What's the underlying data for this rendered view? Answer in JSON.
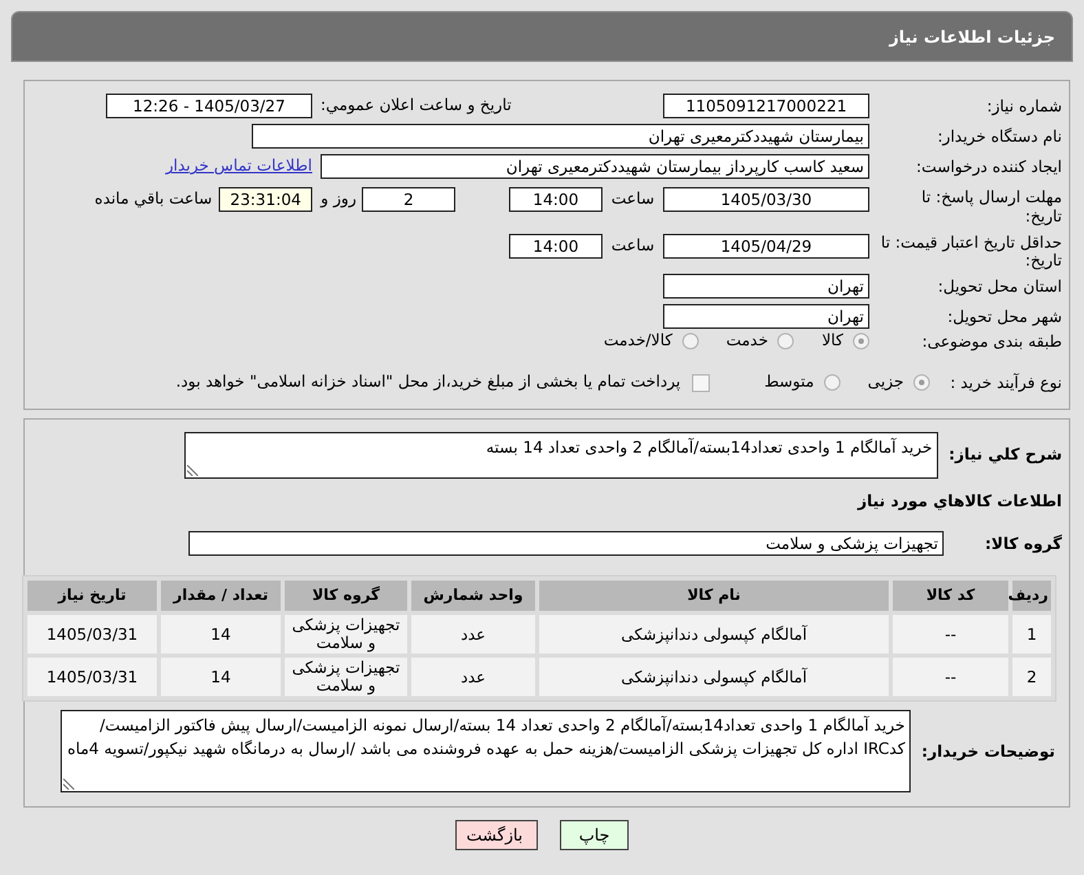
{
  "header": {
    "title": "جزئیات اطلاعات نیاز"
  },
  "form": {
    "need_number": {
      "label": "شماره نیاز:",
      "value": "1105091217000221"
    },
    "announcement": {
      "label": "تاریخ و ساعت اعلان عمومي:",
      "value": "1405/03/27 - 12:26"
    },
    "buyer_org": {
      "label": "نام دستگاه خریدار:",
      "value": "بیمارستان شهیددکترمعیری تهران"
    },
    "requester": {
      "label": "ایجاد کننده درخواست:",
      "value": "سعید کاسب کارپرداز بیمارستان شهیددکترمعیری تهران",
      "contact_link": "اطلاعات تماس خریدار"
    },
    "reply_deadline": {
      "label": "مهلت ارسال پاسخ: تا تاریخ:",
      "date": "1405/03/30",
      "time_label": "ساعت",
      "time": "14:00",
      "days": "2",
      "days_label": "روز و",
      "remaining": "23:31:04",
      "remaining_label": "ساعت باقي مانده"
    },
    "price_validity": {
      "label": "حداقل تاریخ اعتبار قیمت: تا تاریخ:",
      "date": "1405/04/29",
      "time_label": "ساعت",
      "time": "14:00"
    },
    "province": {
      "label": "استان محل تحویل:",
      "value": "تهران"
    },
    "city": {
      "label": "شهر محل تحویل:",
      "value": "تهران"
    },
    "category": {
      "label": "طبقه بندی موضوعی:",
      "options": [
        {
          "label": "کالا",
          "selected": true
        },
        {
          "label": "خدمت",
          "selected": false
        },
        {
          "label": "کالا/خدمت",
          "selected": false
        }
      ]
    },
    "process_type": {
      "label": "نوع فرآیند خرید :",
      "options": [
        {
          "label": "جزیی",
          "selected": true
        },
        {
          "label": "متوسط",
          "selected": false
        }
      ],
      "treasury_payment": {
        "label": "پرداخت تمام یا بخشی از مبلغ خرید،از محل \"اسناد خزانه اسلامی\" خواهد بود.",
        "checked": false
      }
    }
  },
  "details": {
    "description": {
      "label": "شرح کلي نیاز:",
      "value": "خرید آمالگام 1 واحدی تعداد14بسته/آمالگام 2 واحدی تعداد 14 بسته"
    },
    "goods_heading": "اطلاعات کالاهاي مورد نیاز",
    "goods_group": {
      "label": "گروه کالا:",
      "value": "تجهیزات پزشکی و سلامت"
    },
    "table": {
      "columns": [
        "ردیف",
        "کد کالا",
        "نام کالا",
        "واحد شمارش",
        "گروه کالا",
        "تعداد / مقدار",
        "تاریخ نیاز"
      ],
      "rows": [
        [
          "1",
          "--",
          "آمالگام کپسولی دندانپزشکی",
          "عدد",
          "تجهیزات پزشکی و سلامت",
          "14",
          "1405/03/31"
        ],
        [
          "2",
          "--",
          "آمالگام کپسولی دندانپزشکی",
          "عدد",
          "تجهیزات پزشکی و سلامت",
          "14",
          "1405/03/31"
        ]
      ]
    },
    "buyer_notes": {
      "label": "توضیحات خریدار:",
      "value": "خرید آمالگام 1 واحدی تعداد14بسته/آمالگام 2 واحدی تعداد 14 بسته/ارسال نمونه الزامیست/ارسال پیش فاکتور الزامیست/کدIRC اداره کل تجهیزات پزشکی الزامیست/هزینه حمل به عهده فروشنده می باشد /ارسال به درمانگاه شهید نیکپور/تسویه 4ماه"
    }
  },
  "buttons": [
    {
      "kind": "print",
      "label": "چاپ"
    },
    {
      "kind": "back",
      "label": "بازگشت"
    }
  ]
}
